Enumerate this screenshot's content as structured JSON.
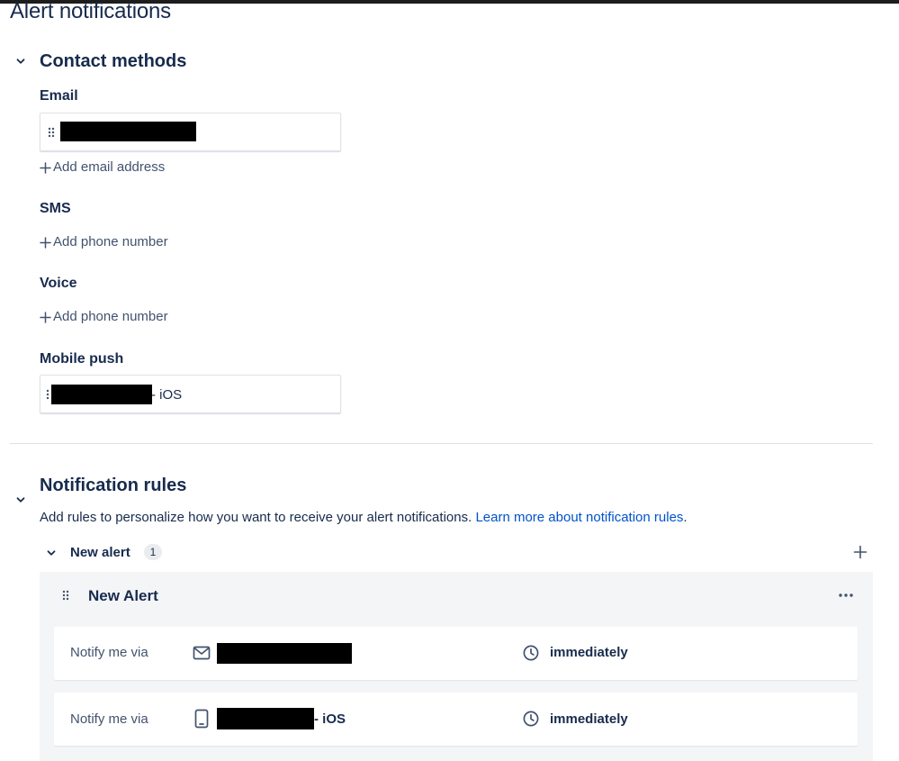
{
  "page": {
    "title": "Alert notifications"
  },
  "contact_methods": {
    "title": "Contact methods",
    "email": {
      "label": "Email",
      "add_label": "Add email address"
    },
    "sms": {
      "label": "SMS",
      "add_label": "Add phone number"
    },
    "voice": {
      "label": "Voice",
      "add_label": "Add phone number"
    },
    "mobile_push": {
      "label": "Mobile push",
      "device_suffix": "- iOS"
    }
  },
  "notification_rules": {
    "title": "Notification rules",
    "description": "Add rules to personalize how you want to receive your alert notifications. ",
    "learn_more": "Learn more about notification rules",
    "period": ".",
    "group": {
      "label": "New alert",
      "count": "1"
    },
    "rule": {
      "title": "New Alert",
      "rows": [
        {
          "label": "Notify me via",
          "channel_icon": "mail-icon",
          "suffix": "",
          "timing": "immediately"
        },
        {
          "label": "Notify me via",
          "channel_icon": "mobile-icon",
          "suffix": "- iOS",
          "timing": "immediately"
        }
      ]
    }
  },
  "colors": {
    "text": "#172b4d",
    "link": "#0052cc",
    "subtle": "#42526e",
    "card_bg": "#f4f5f7",
    "border": "#dfe1e6"
  }
}
